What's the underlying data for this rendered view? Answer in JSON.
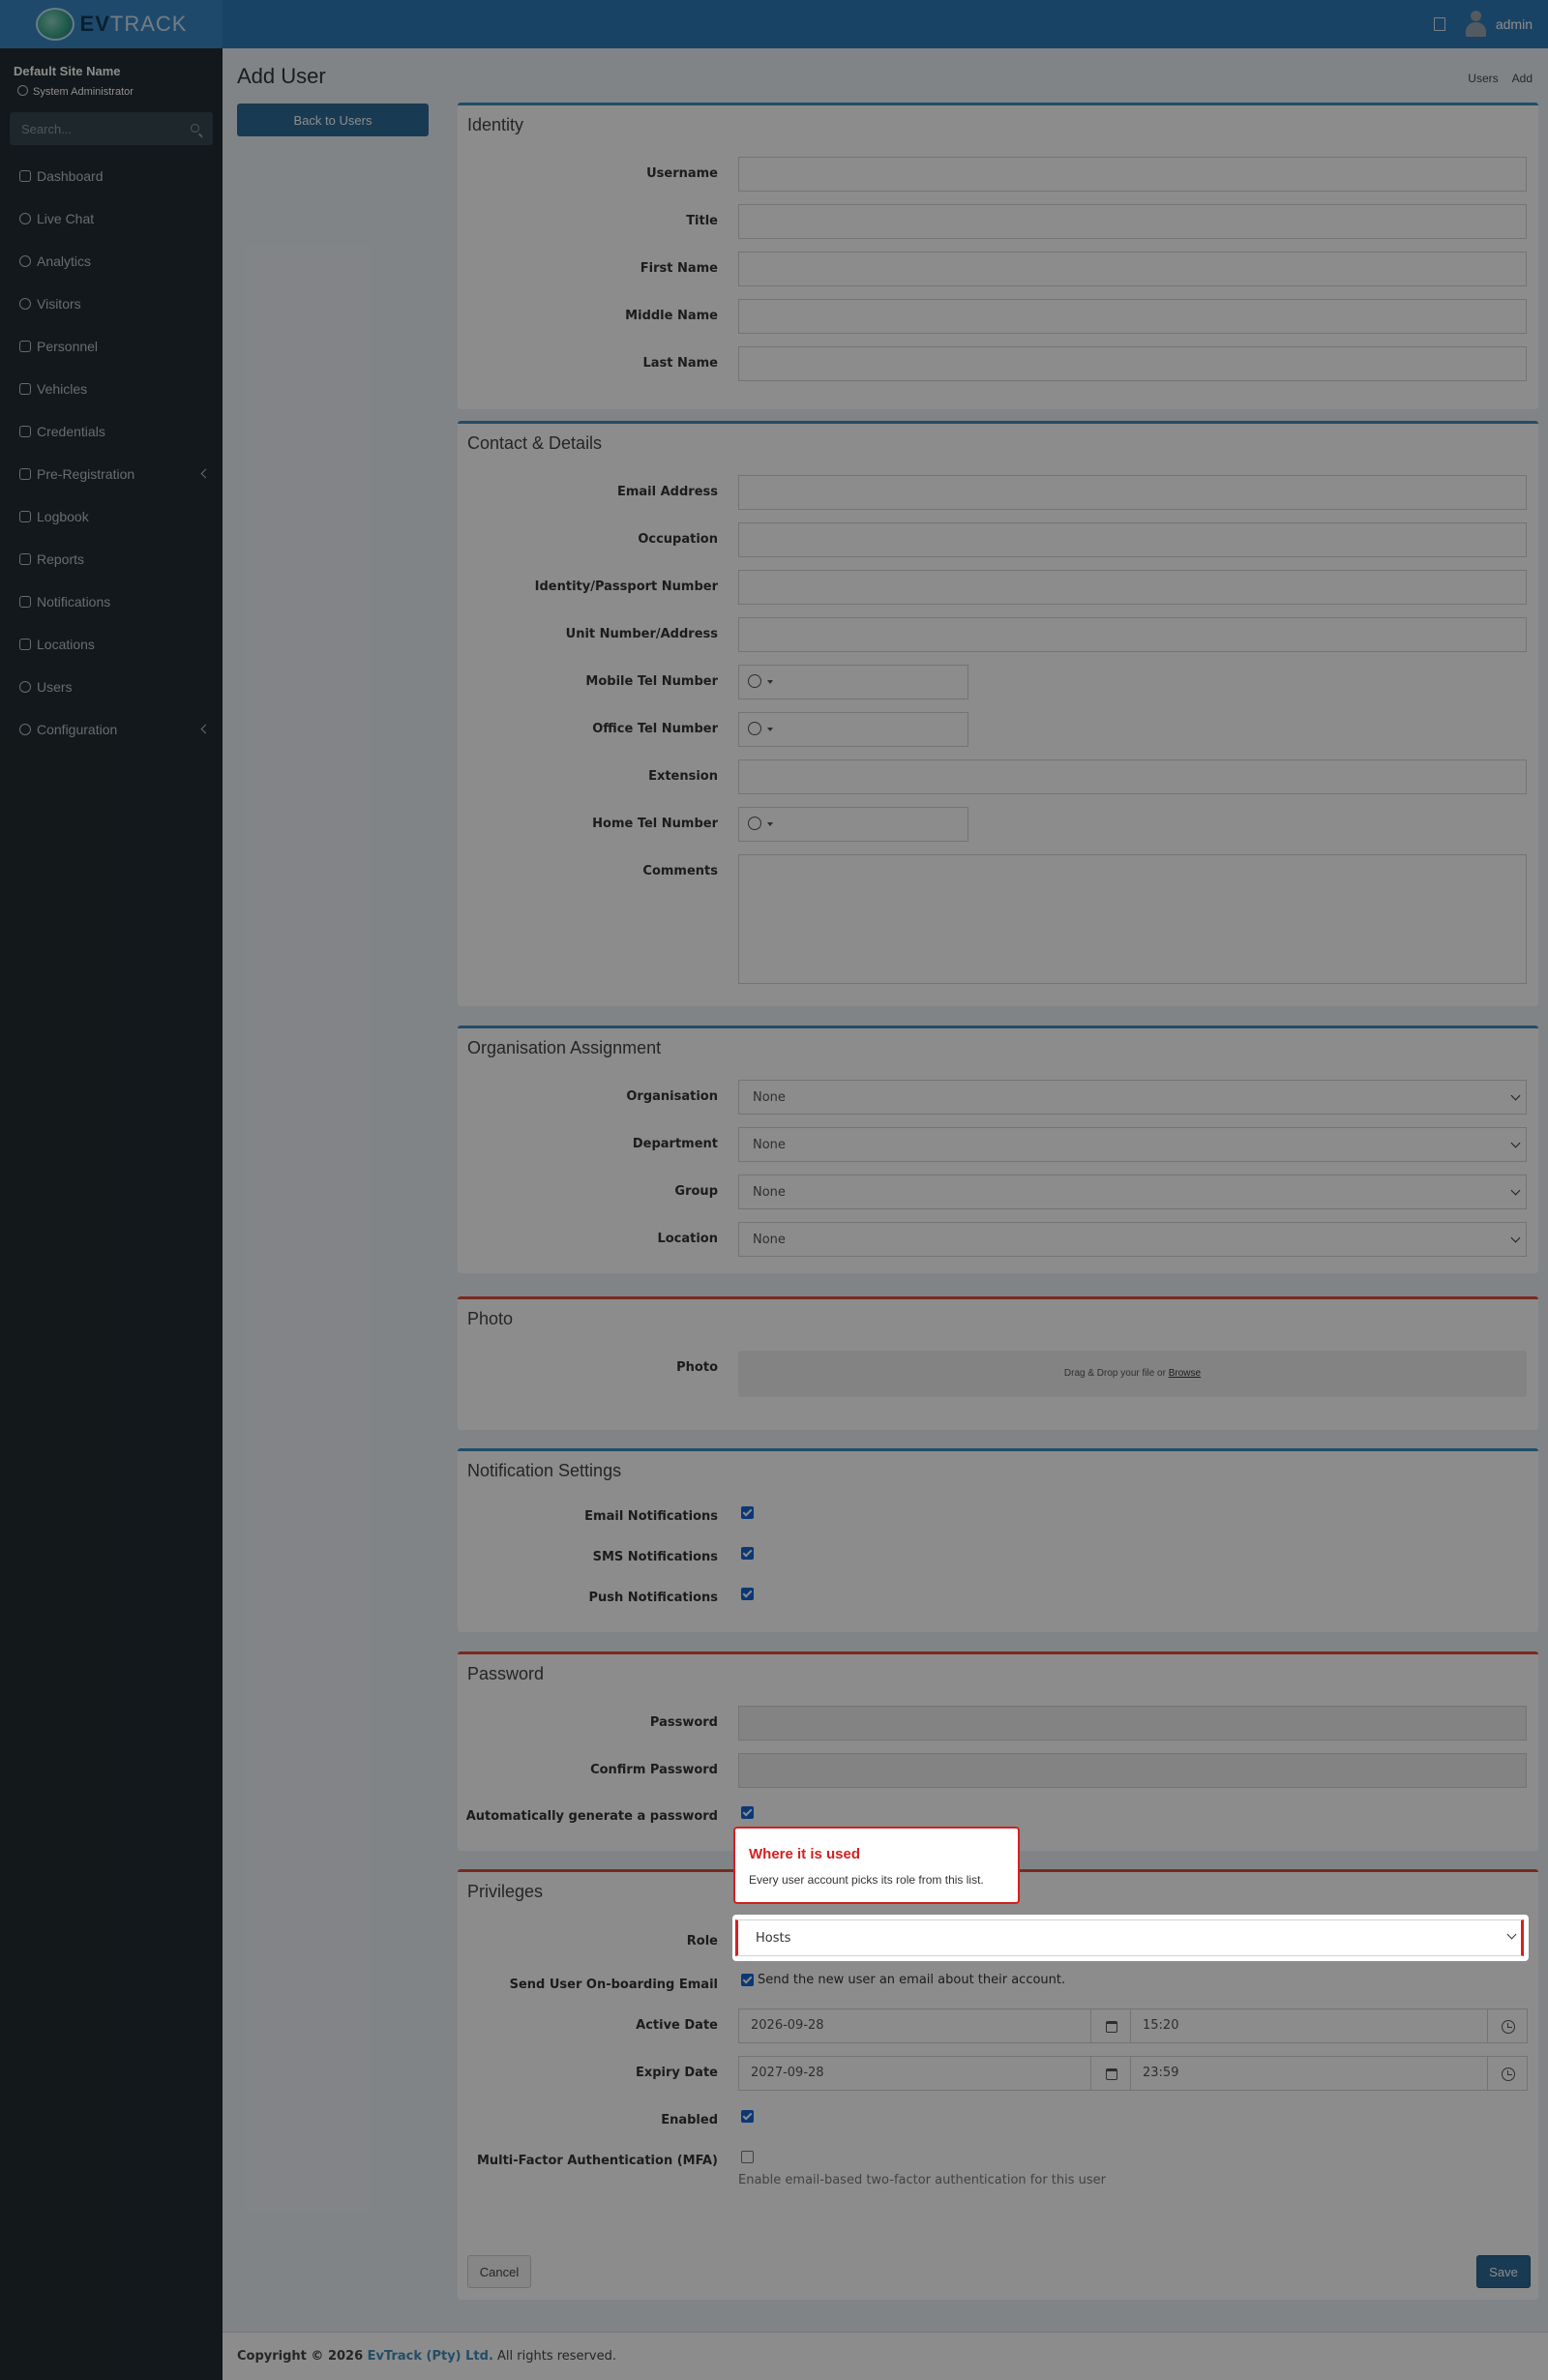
{
  "app": {
    "logo_text_bold": "EV",
    "logo_text_light": "TRACK",
    "user": "admin"
  },
  "sidebar": {
    "site_name": "Default Site Name",
    "role": "System Administrator",
    "search_placeholder": "Search...",
    "items": [
      {
        "label": "Dashboard",
        "icon": "dashboard-icon"
      },
      {
        "label": "Live Chat",
        "icon": "headset-icon"
      },
      {
        "label": "Analytics",
        "icon": "analytics-icon"
      },
      {
        "label": "Visitors",
        "icon": "eye-icon"
      },
      {
        "label": "Personnel",
        "icon": "user-tie-icon"
      },
      {
        "label": "Vehicles",
        "icon": "car-icon"
      },
      {
        "label": "Credentials",
        "icon": "id-card-icon"
      },
      {
        "label": "Pre-Registration",
        "icon": "exchange-icon"
      },
      {
        "label": "Logbook",
        "icon": "book-icon"
      },
      {
        "label": "Reports",
        "icon": "chart-icon"
      },
      {
        "label": "Notifications",
        "icon": "comment-icon"
      },
      {
        "label": "Locations",
        "icon": "building-icon"
      },
      {
        "label": "Users",
        "icon": "users-icon"
      },
      {
        "label": "Configuration",
        "icon": "gear-icon"
      }
    ]
  },
  "page": {
    "title": "Add User",
    "breadcrumb": [
      "Users",
      "Add"
    ],
    "back_label": "Back to Users"
  },
  "identity": {
    "title": "Identity",
    "username": "Username",
    "title_field": "Title",
    "first_name": "First Name",
    "middle_name": "Middle Name",
    "last_name": "Last Name"
  },
  "contact": {
    "title": "Contact & Details",
    "email": "Email Address",
    "occupation": "Occupation",
    "id_number": "Identity/Passport Number",
    "unit": "Unit Number/Address",
    "mobile": "Mobile Tel Number",
    "office": "Office Tel Number",
    "extension": "Extension",
    "home": "Home Tel Number",
    "comments": "Comments"
  },
  "organisation": {
    "title": "Organisation Assignment",
    "organisation": "Organisation",
    "department": "Department",
    "group": "Group",
    "location": "Location",
    "none_option": "None"
  },
  "photo": {
    "title": "Photo",
    "label": "Photo",
    "drop_text": "Drag & Drop your file or ",
    "browse": "Browse"
  },
  "notifications": {
    "title": "Notification Settings",
    "email": "Email Notifications",
    "sms": "SMS Notifications",
    "push": "Push Notifications"
  },
  "password": {
    "title": "Password",
    "password": "Password",
    "confirm": "Confirm Password",
    "auto": "Automatically generate a password"
  },
  "privileges": {
    "title": "Privileges",
    "role_label": "Role",
    "role_value": "Hosts",
    "onboarding_label": "Send User On-boarding Email",
    "onboarding_text": "Send the new user an email about their account.",
    "active_label": "Active Date",
    "active_date": "2026-09-28",
    "active_time": "15:20",
    "expiry_label": "Expiry Date",
    "expiry_date": "2027-09-28",
    "expiry_time": "23:59",
    "enabled_label": "Enabled",
    "mfa_label": "Multi-Factor Authentication (MFA)",
    "mfa_help": "Enable email-based two-factor authentication for this user"
  },
  "actions": {
    "cancel": "Cancel",
    "save": "Save"
  },
  "tooltip": {
    "title": "Where it is used",
    "body": "Every user account picks its role from this list."
  },
  "footer": {
    "prefix": "Copyright © 2026 ",
    "company": "EvTrack (Pty) Ltd.",
    "suffix": " All rights reserved."
  },
  "colors": {
    "topbar": "#2f7bb8",
    "sidebar": "#222d32",
    "primary_box": "#3c8dbc",
    "danger_box": "#dd4b39",
    "highlight": "#d61f1f"
  }
}
